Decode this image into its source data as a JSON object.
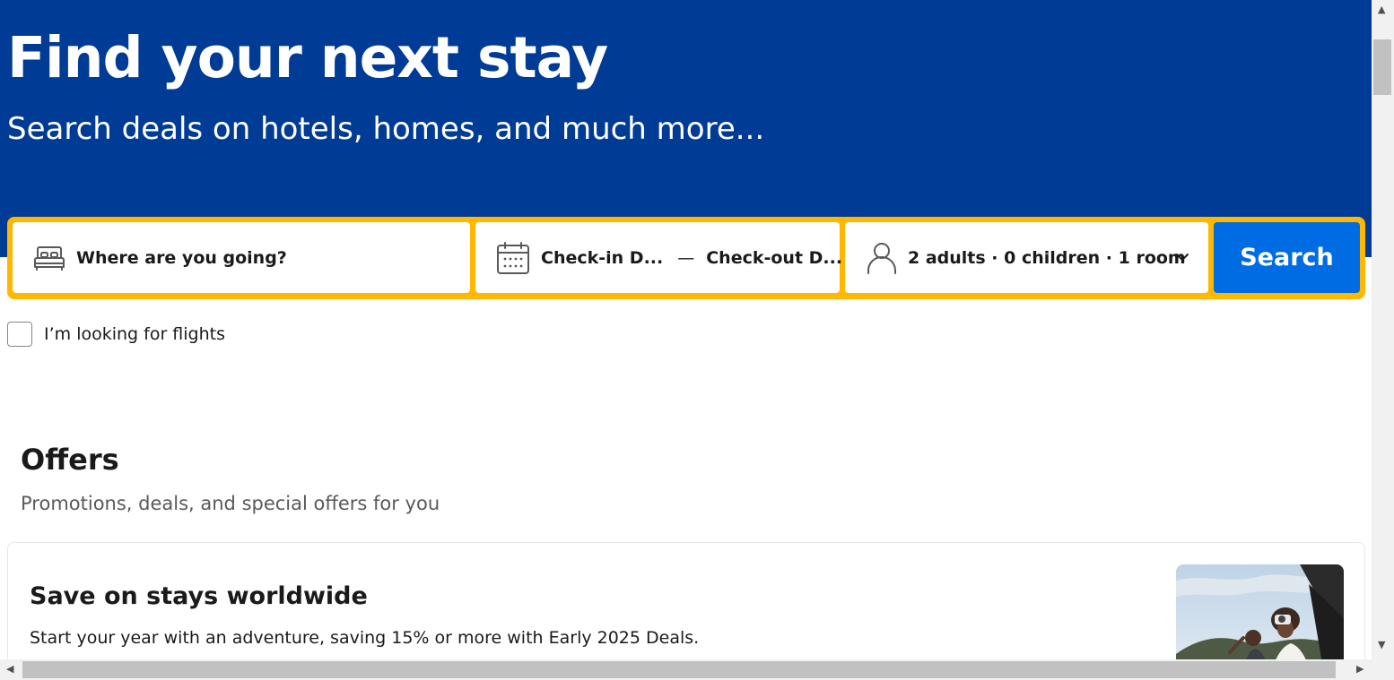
{
  "hero": {
    "title": "Find your next stay",
    "subtitle": "Search deals on hotels, homes, and much more..."
  },
  "search": {
    "destination_placeholder": "Where are you going?",
    "checkin": "Check-in D...",
    "dash": "—",
    "checkout": "Check-out D...",
    "occupancy": "2 adults · 0 children · 1 room",
    "button_label": "Search"
  },
  "flights_checkbox": {
    "label": "I’m looking for flights",
    "checked": false
  },
  "offers": {
    "title": "Offers",
    "subtitle": "Promotions, deals, and special offers for you",
    "cards": [
      {
        "title": "Save on stays worldwide",
        "description": "Start your year with an adventure, saving 15% or more with Early 2025 Deals."
      }
    ]
  },
  "icons": {
    "destination": "bed-icon",
    "dates": "calendar-icon",
    "occupancy": "person-icon",
    "dropdown": "chevron-down-icon"
  },
  "colors": {
    "hero_bg": "#003b95",
    "search_border": "#ffb700",
    "search_button": "#006ce4"
  }
}
